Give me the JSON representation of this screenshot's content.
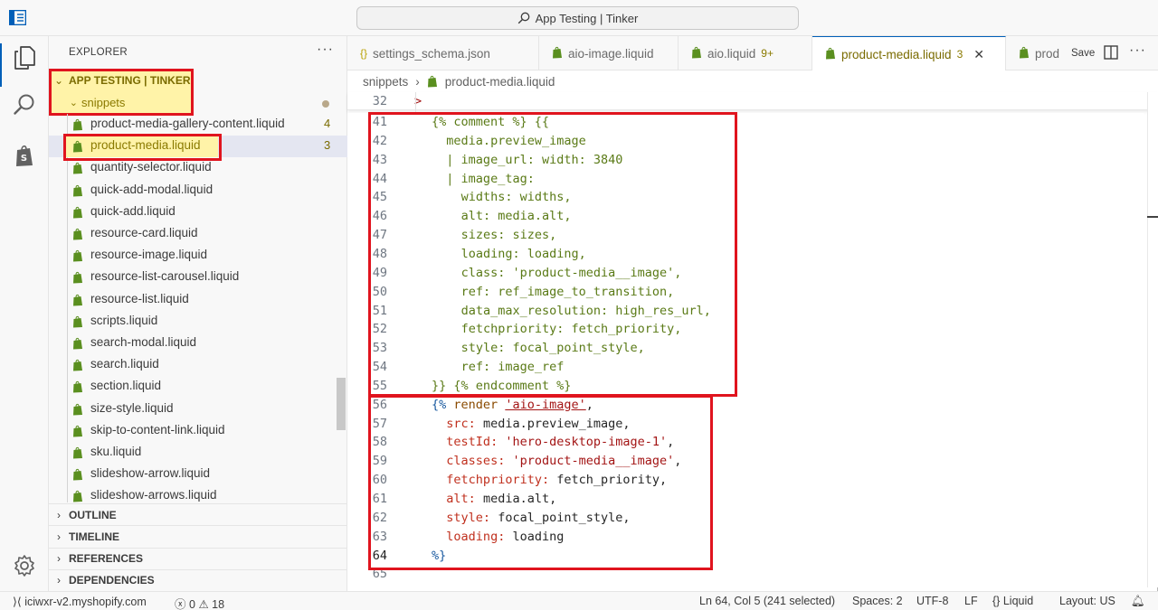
{
  "titlebar": {
    "search_text": "App Testing | Tinker",
    "logo_icon": "layout-sidebar-icon",
    "search_icon": "search-icon"
  },
  "activitybar": {
    "items": [
      {
        "icon": "files-icon",
        "active": true
      },
      {
        "icon": "search-icon",
        "active": false
      },
      {
        "icon": "shopify-bag-icon",
        "active": false
      }
    ],
    "bottom_icon": "gear-icon",
    "accent_color": "#005fb8"
  },
  "sidebar": {
    "title": "EXPLORER",
    "more": "···",
    "root_folder": "APP TESTING | TINKER",
    "sub_folder": "snippets",
    "files": [
      {
        "name": "product-media-gallery-content.liquid",
        "badge": "4",
        "warn": false,
        "selected": false
      },
      {
        "name": "product-media.liquid",
        "badge": "3",
        "warn": true,
        "selected": true
      },
      {
        "name": "quantity-selector.liquid",
        "badge": "",
        "warn": false,
        "selected": false
      },
      {
        "name": "quick-add-modal.liquid",
        "badge": "",
        "warn": false,
        "selected": false
      },
      {
        "name": "quick-add.liquid",
        "badge": "",
        "warn": false,
        "selected": false
      },
      {
        "name": "resource-card.liquid",
        "badge": "",
        "warn": false,
        "selected": false
      },
      {
        "name": "resource-image.liquid",
        "badge": "",
        "warn": false,
        "selected": false
      },
      {
        "name": "resource-list-carousel.liquid",
        "badge": "",
        "warn": false,
        "selected": false
      },
      {
        "name": "resource-list.liquid",
        "badge": "",
        "warn": false,
        "selected": false
      },
      {
        "name": "scripts.liquid",
        "badge": "",
        "warn": false,
        "selected": false
      },
      {
        "name": "search-modal.liquid",
        "badge": "",
        "warn": false,
        "selected": false
      },
      {
        "name": "search.liquid",
        "badge": "",
        "warn": false,
        "selected": false
      },
      {
        "name": "section.liquid",
        "badge": "",
        "warn": false,
        "selected": false
      },
      {
        "name": "size-style.liquid",
        "badge": "",
        "warn": false,
        "selected": false
      },
      {
        "name": "skip-to-content-link.liquid",
        "badge": "",
        "warn": false,
        "selected": false
      },
      {
        "name": "sku.liquid",
        "badge": "",
        "warn": false,
        "selected": false
      },
      {
        "name": "slideshow-arrow.liquid",
        "badge": "",
        "warn": false,
        "selected": false
      },
      {
        "name": "slideshow-arrows.liquid",
        "badge": "",
        "warn": false,
        "selected": false
      }
    ],
    "sections": [
      "OUTLINE",
      "TIMELINE",
      "REFERENCES",
      "DEPENDENCIES"
    ],
    "file_icon": "shopify-liquid-file-icon",
    "file_icon_color": "#5a8f1f"
  },
  "tabs": {
    "items": [
      {
        "icon": "{}",
        "label": "settings_schema.json",
        "badge": "",
        "active": false,
        "closable": false
      },
      {
        "icon": "liquid",
        "label": "aio-image.liquid",
        "badge": "",
        "active": false,
        "closable": false
      },
      {
        "icon": "liquid",
        "label": "aio.liquid",
        "badge": "9+",
        "active": false,
        "closable": false
      },
      {
        "icon": "liquid",
        "label": "product-media.liquid",
        "badge": "3",
        "active": true,
        "closable": true
      },
      {
        "icon": "liquid",
        "label": "prod",
        "badge": "",
        "active": false,
        "closable": false
      }
    ],
    "save_label": "Save",
    "split_icon": "split-editor-icon",
    "more": "···",
    "close_glyph": "✕"
  },
  "breadcrumb": {
    "folder": "snippets",
    "separator": "›",
    "file": "product-media.liquid"
  },
  "sticky": {
    "number": "32",
    "text": ">"
  },
  "code_lines": [
    {
      "n": "41",
      "parts": [
        [
          "cm",
          "{% comment %} {{"
        ]
      ],
      "indent": 1
    },
    {
      "n": "42",
      "parts": [
        [
          "cm",
          "media.preview_image"
        ]
      ],
      "indent": 2
    },
    {
      "n": "43",
      "parts": [
        [
          "cm",
          "| image_url: width: 3840"
        ]
      ],
      "indent": 2
    },
    {
      "n": "44",
      "parts": [
        [
          "cm",
          "| image_tag:"
        ]
      ],
      "indent": 2
    },
    {
      "n": "45",
      "parts": [
        [
          "cm",
          "widths: widths,"
        ]
      ],
      "indent": 3
    },
    {
      "n": "46",
      "parts": [
        [
          "cm",
          "alt: media.alt,"
        ]
      ],
      "indent": 3
    },
    {
      "n": "47",
      "parts": [
        [
          "cm",
          "sizes: sizes,"
        ]
      ],
      "indent": 3
    },
    {
      "n": "48",
      "parts": [
        [
          "cm",
          "loading: loading,"
        ]
      ],
      "indent": 3
    },
    {
      "n": "49",
      "parts": [
        [
          "cm",
          "class: 'product-media__image',"
        ]
      ],
      "indent": 3
    },
    {
      "n": "50",
      "parts": [
        [
          "cm",
          "ref: ref_image_to_transition,"
        ]
      ],
      "indent": 3
    },
    {
      "n": "51",
      "parts": [
        [
          "cm",
          "data_max_resolution: high_res_url,"
        ]
      ],
      "indent": 3
    },
    {
      "n": "52",
      "parts": [
        [
          "cm",
          "fetchpriority: fetch_priority,"
        ]
      ],
      "indent": 3
    },
    {
      "n": "53",
      "parts": [
        [
          "cm",
          "style: focal_point_style,"
        ]
      ],
      "indent": 3
    },
    {
      "n": "54",
      "parts": [
        [
          "cm",
          "ref: image_ref"
        ]
      ],
      "indent": 3
    },
    {
      "n": "55",
      "parts": [
        [
          "cm",
          "}} {% endcomment %}"
        ]
      ],
      "indent": 1
    },
    {
      "n": "56",
      "parts": [
        [
          "tag",
          "{%"
        ],
        [
          "var",
          " "
        ],
        [
          "kw",
          "render"
        ],
        [
          "var",
          " "
        ],
        [
          "str",
          "'aio-image'"
        ],
        [
          "var",
          ","
        ]
      ],
      "indent": 1
    },
    {
      "n": "57",
      "parts": [
        [
          "pr",
          "src:"
        ],
        [
          "var",
          " media.preview_image,"
        ]
      ],
      "indent": 2
    },
    {
      "n": "58",
      "parts": [
        [
          "pr",
          "testId:"
        ],
        [
          "var",
          " "
        ],
        [
          "str",
          "'hero-desktop-image-1'"
        ],
        [
          "var",
          ","
        ]
      ],
      "indent": 2
    },
    {
      "n": "59",
      "parts": [
        [
          "pr",
          "classes:"
        ],
        [
          "var",
          " "
        ],
        [
          "str",
          "'product-media__image'"
        ],
        [
          "var",
          ","
        ]
      ],
      "indent": 2
    },
    {
      "n": "60",
      "parts": [
        [
          "pr",
          "fetchpriority:"
        ],
        [
          "var",
          " fetch_priority,"
        ]
      ],
      "indent": 2
    },
    {
      "n": "61",
      "parts": [
        [
          "pr",
          "alt:"
        ],
        [
          "var",
          " media.alt,"
        ]
      ],
      "indent": 2
    },
    {
      "n": "62",
      "parts": [
        [
          "pr",
          "style:"
        ],
        [
          "var",
          " focal_point_style,"
        ]
      ],
      "indent": 2
    },
    {
      "n": "63",
      "parts": [
        [
          "pr",
          "loading:"
        ],
        [
          "var",
          " loading"
        ]
      ],
      "indent": 2
    },
    {
      "n": "64",
      "parts": [
        [
          "tag",
          "%}"
        ]
      ],
      "indent": 1
    },
    {
      "n": "65",
      "parts": [],
      "indent": 0
    }
  ],
  "status": {
    "remote": "iciwxr-v2.myshopify.com",
    "errors": "0",
    "warnings": "18",
    "position": "Ln 64, Col 5 (241 selected)",
    "spaces": "Spaces: 2",
    "encoding": "UTF-8",
    "eol": "LF",
    "language": "Liquid",
    "layout": "Layout: US"
  },
  "colors": {
    "highlight_red": "#e0141e",
    "highlight_yellow": "#fff3a8",
    "comment_block_bg": "#f8d0d2",
    "selection_bg": "#bfd9a3"
  }
}
